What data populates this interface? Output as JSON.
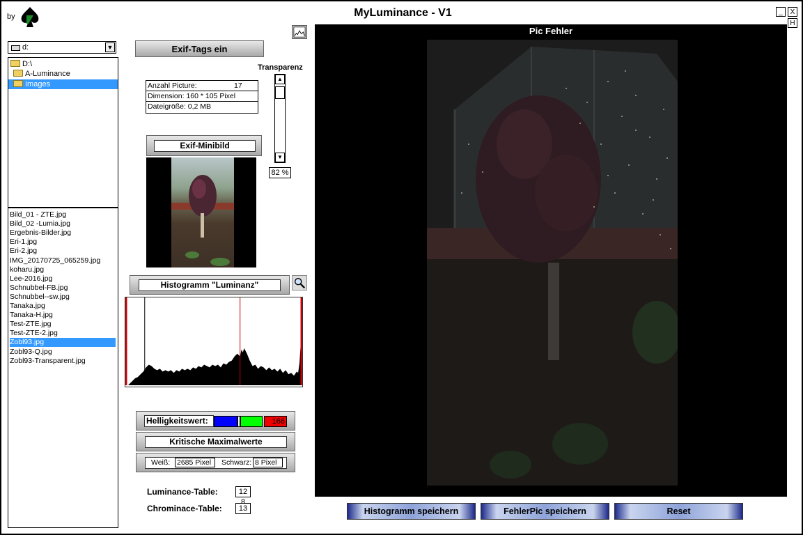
{
  "window": {
    "title": "MyLuminance - V1",
    "by_label": "by",
    "minimize_label": "_",
    "close_label": "X",
    "help_label": "H"
  },
  "drive": {
    "label": "d:"
  },
  "tree": {
    "items": [
      {
        "label": "D:\\"
      },
      {
        "label": "A-Luminance"
      },
      {
        "label": "Images"
      }
    ]
  },
  "files": [
    "Bild_01 - ZTE.jpg",
    "Bild_02 -Lumia.jpg",
    "Ergebnis-Bilder.jpg",
    "Eri-1.jpg",
    "Eri-2.jpg",
    "IMG_20170725_065259.jpg",
    "koharu.jpg",
    "Lee-2016.jpg",
    "Schnubbel-FB.jpg",
    "Schnubbel--sw.jpg",
    "Tanaka.jpg",
    "Tanaka-H.jpg",
    "Test-ZTE.jpg",
    "Test-ZTE-2.jpg",
    "Zobl93.jpg",
    "Zobl93-Q.jpg",
    "Zobl93-Transparent.jpg"
  ],
  "selected_file_index": 14,
  "exif": {
    "button_label": "Exif-Tags ein",
    "count_label": "Anzahl Picture:",
    "count_value": "17",
    "dimension": "Dimension: 160 * 105 Pixel",
    "filesize": "Dateigröße: 0,2 MB",
    "minibild_label": "Exif-Minibild"
  },
  "transparency": {
    "label": "Transparenz",
    "value_text": "82 %",
    "value": 82,
    "scroll_up": "▲",
    "scroll_down": "▼"
  },
  "histogram": {
    "label": "Histogramm \"Luminanz\""
  },
  "helligkeit": {
    "label": "Helligkeitswert:",
    "value": "166",
    "colors": {
      "blue": "#0000ff",
      "green": "#00ff00",
      "red": "#ff0000"
    }
  },
  "kritische": {
    "label": "Kritische Maximalwerte",
    "weiss_label": "Weiß:",
    "weiss_value": "2685  Pixel",
    "schwarz_label": "Schwarz:",
    "schwarz_value": "8  Pixel"
  },
  "tables": {
    "luminance_label": "Luminance-Table:",
    "luminance_value": "12 8",
    "chrominance_label": "Chrominace-Table:",
    "chrominance_value": "13"
  },
  "preview": {
    "title": "Pic Fehler"
  },
  "buttons": {
    "save_histogram": "Histogramm speichern",
    "save_fehlerpic": "FehlerPic speichern",
    "reset": "Reset"
  }
}
